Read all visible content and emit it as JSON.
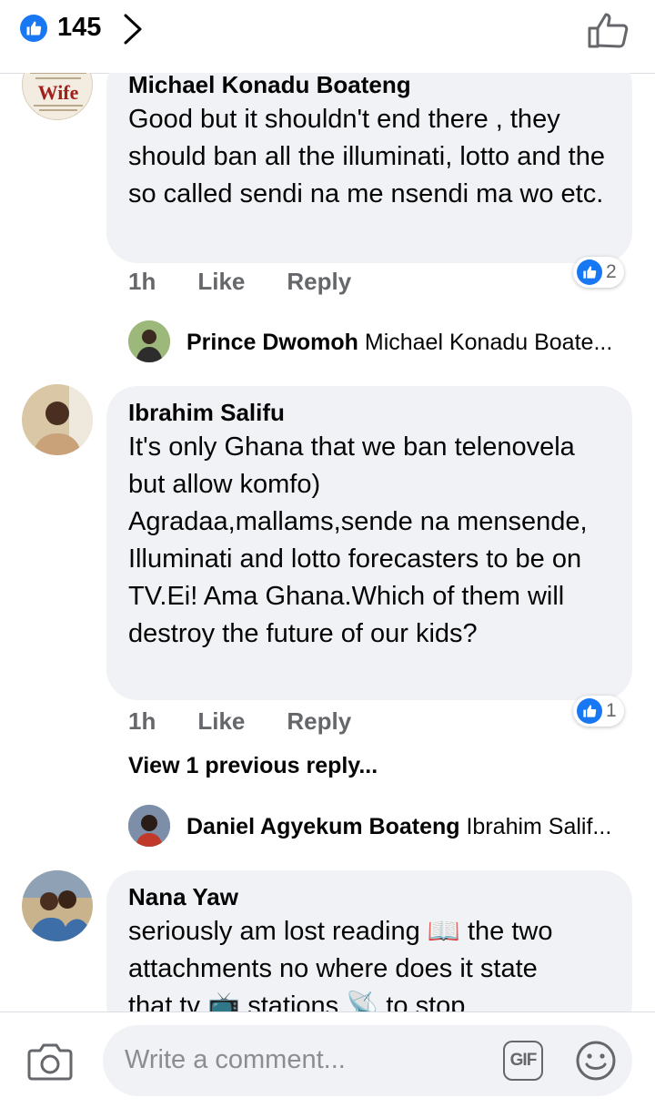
{
  "header": {
    "like_count": "145"
  },
  "comments": [
    {
      "author": "Michael Konadu Boateng",
      "text": "Good but it shouldn't end there , they should ban all the illuminati, lotto and the so called sendi na me nsendi ma wo etc.",
      "time": "1h",
      "like_label": "Like",
      "reply_label": "Reply",
      "reaction_count": "2",
      "avatar_text": "Wife",
      "reply_preview": {
        "author": "Prince Dwomoh",
        "snippet": "Michael Konadu Boate..."
      }
    },
    {
      "author": "Ibrahim Salifu",
      "text": "It's only Ghana that we ban telenovela but allow komfo) Agradaa,mallams,sende na mensende, Illuminati and lotto forecasters to be on TV.Ei! Ama Ghana.Which of them will destroy the future of our kids?",
      "time": "1h",
      "like_label": "Like",
      "reply_label": "Reply",
      "reaction_count": "1",
      "view_previous": "View 1 previous reply...",
      "reply_preview": {
        "author": "Daniel Agyekum Boateng",
        "snippet": "Ibrahim Salif..."
      }
    },
    {
      "author": "Nana Yaw",
      "text_line1": "seriously am lost reading 📖 the two",
      "text_line2": "attachments no where does it state",
      "text_line3": "that tv 📺 stations 📡 to stop"
    }
  ],
  "composer": {
    "placeholder": "Write a comment...",
    "gif_label": "GIF"
  },
  "colors": {
    "accent": "#1877f2",
    "bubble": "#f0f2f5",
    "muted": "#65676b"
  }
}
